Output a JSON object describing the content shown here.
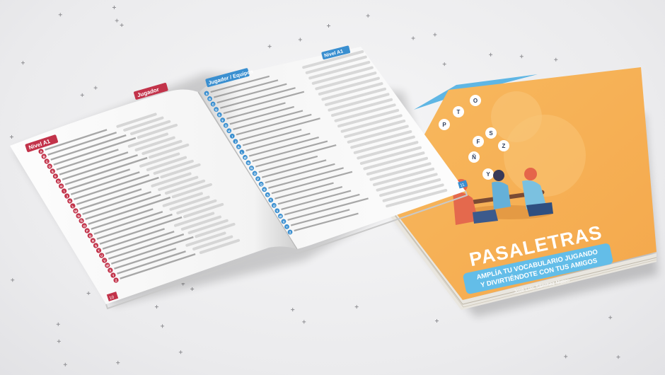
{
  "book": {
    "title": "PASALETRAS",
    "subtitle_line1": "AMPLÍA TU VOCABULARIO JUGANDO",
    "subtitle_line2": "Y DIVIRTIÉNDOTE CON TUS AMIGOS",
    "author": "José Luis Sánchez Mateo",
    "cover_letters": [
      "P",
      "T",
      "O",
      "F",
      "Ñ",
      "S",
      "Z",
      "Y"
    ]
  },
  "open_book": {
    "left_level": "Nivel A1",
    "left_section": "Jugador",
    "right_section": "Jugador / Equipos",
    "right_level": "Nivel A1",
    "left_letters": [
      "A",
      "B",
      "C",
      "D",
      "E",
      "F",
      "G",
      "H",
      "I",
      "J",
      "K",
      "L",
      "M",
      "N",
      "Ñ",
      "O",
      "P",
      "Q",
      "R",
      "S",
      "T",
      "U",
      "V",
      "W",
      "X",
      "Y",
      "Z"
    ],
    "right_letters": [
      "A",
      "B",
      "C",
      "D",
      "E",
      "F",
      "G",
      "H",
      "I",
      "J",
      "K",
      "L",
      "M",
      "N",
      "Ñ",
      "O",
      "P",
      "Q",
      "R",
      "S",
      "T",
      "U",
      "V",
      "W",
      "X",
      "Y",
      "Z"
    ],
    "left_page_number": "10",
    "right_page_number": "11"
  },
  "colors": {
    "cover_orange": "#f7b35a",
    "cover_blue": "#63bde8",
    "left_accent": "#c2334a",
    "right_accent": "#3a8fd0"
  }
}
